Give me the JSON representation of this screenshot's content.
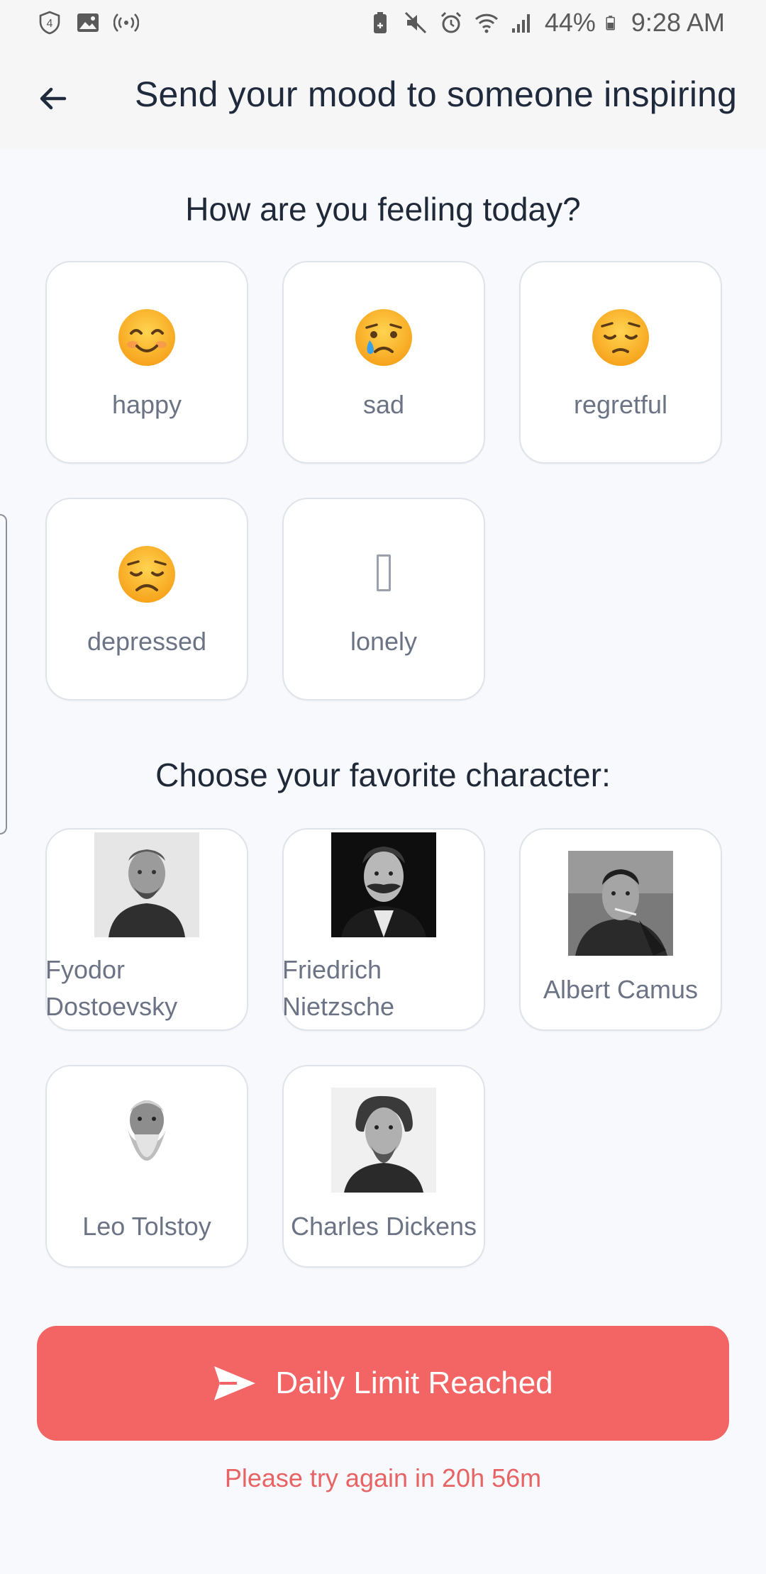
{
  "status_bar": {
    "battery": "44%",
    "time": "9:28 AM",
    "notification_count": "4"
  },
  "header": {
    "title": "Send your mood to someone inspiring"
  },
  "mood_section": {
    "title": "How are you feeling today?",
    "moods": [
      {
        "label": "happy",
        "icon": "smiling-face-icon"
      },
      {
        "label": "sad",
        "icon": "crying-face-icon"
      },
      {
        "label": "regretful",
        "icon": "pensive-face-icon"
      },
      {
        "label": "depressed",
        "icon": "disappointed-face-icon"
      },
      {
        "label": "lonely",
        "icon": "missing-glyph-icon"
      }
    ]
  },
  "character_section": {
    "title": "Choose your favorite character:",
    "characters": [
      {
        "name": "Fyodor Dostoevsky",
        "line1": "Fyodor",
        "line2": "Dostoevsky"
      },
      {
        "name": "Friedrich Nietzsche",
        "line1": "Friedrich",
        "line2": "Nietzsche"
      },
      {
        "name": "Albert Camus"
      },
      {
        "name": "Leo Tolstoy"
      },
      {
        "name": "Charles Dickens"
      }
    ]
  },
  "send_button": {
    "label": "Daily Limit Reached",
    "color": "#f36565"
  },
  "retry_message": "Please try again in 20h 56m",
  "colors": {
    "accent": "#f36565",
    "retry_text": "#e86363",
    "background": "#f8f9fd"
  }
}
